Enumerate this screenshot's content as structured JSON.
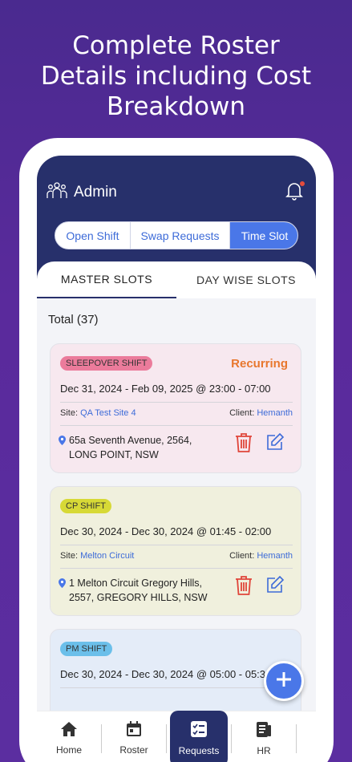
{
  "promo": {
    "title_line1": "Complete Roster",
    "title_line2": "Details including Cost",
    "title_line3": "Breakdown"
  },
  "appbar": {
    "title": "Admin",
    "icons": [
      "users-icon",
      "bell-icon"
    ]
  },
  "segments": {
    "items": [
      "Open Shift",
      "Swap Requests",
      "Time Slot"
    ],
    "active": "Time Slot"
  },
  "tabs": {
    "items": [
      "MASTER SLOTS",
      "DAY WISE SLOTS"
    ],
    "active": "MASTER SLOTS"
  },
  "list": {
    "total_label": "Total (37)",
    "cards": [
      {
        "badge": "SLEEPOVER SHIFT",
        "status": "Recurring",
        "dates": "Dec 31, 2024 - Feb 09, 2025 @ 23:00 - 07:00",
        "site_label": "Site:",
        "site": "QA Test Site 4",
        "client_label": "Client:",
        "client": "Hemanth",
        "address_line1": "65a Seventh Avenue, 2564,",
        "address_line2": "LONG POINT, NSW"
      },
      {
        "badge": "CP SHIFT",
        "dates": "Dec 30, 2024 - Dec 30, 2024 @ 01:45 - 02:00",
        "site_label": "Site:",
        "site": "Melton Circuit",
        "client_label": "Client:",
        "client": "Hemanth",
        "address_line1": "1 Melton Circuit Gregory Hills,",
        "address_line2": "2557, GREGORY HILLS, NSW"
      },
      {
        "badge": "PM SHIFT",
        "dates": "Dec 30, 2024 - Dec 30, 2024 @ 05:00 - 05:30"
      }
    ]
  },
  "bottom_nav": {
    "items": [
      "Home",
      "Roster",
      "Requests",
      "HR"
    ],
    "active": "Requests"
  },
  "colors": {
    "primary_dark": "#27306b",
    "accent_blue": "#4a77e8",
    "recurring_orange": "#e8772e",
    "delete_red": "#e0453a"
  }
}
